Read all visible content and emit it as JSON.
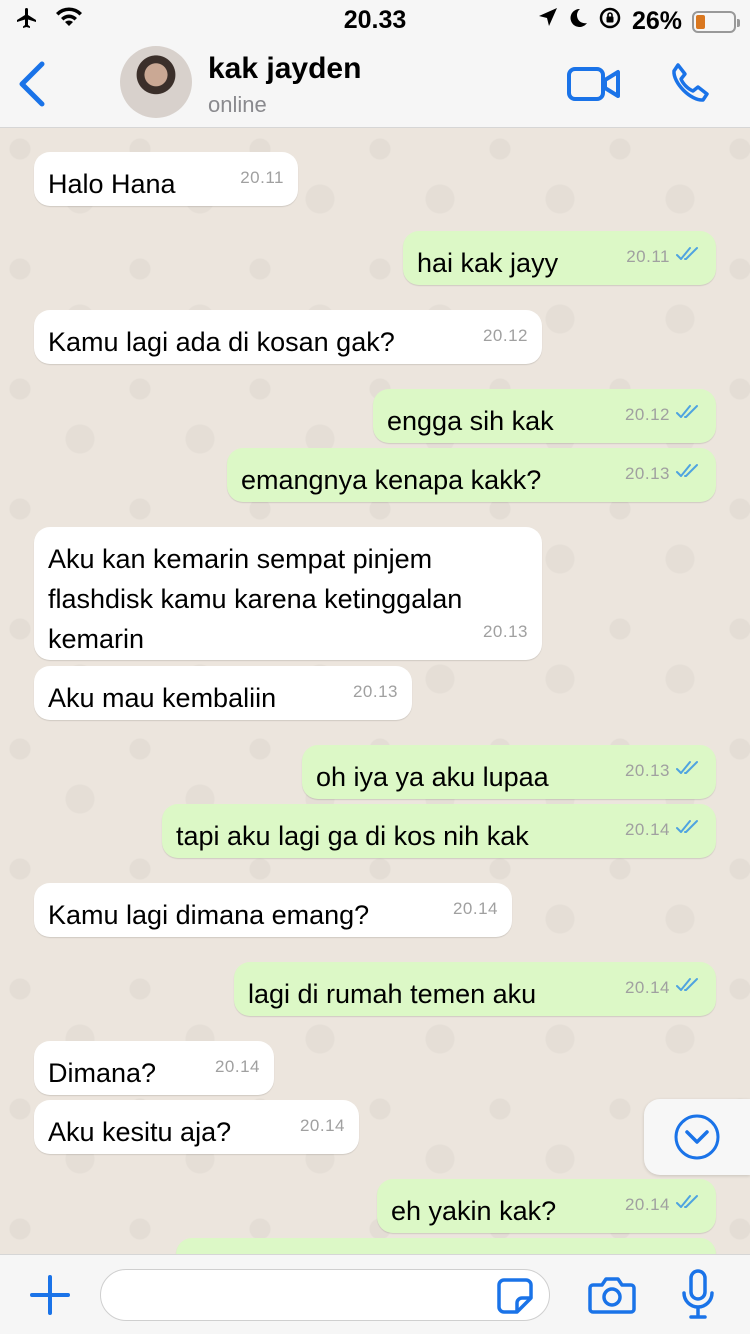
{
  "status_bar": {
    "time": "20.33",
    "battery_text": "26%",
    "battery_level": 0.26,
    "battery_color": "#d9771f"
  },
  "header": {
    "contact_name": "kak jayden",
    "contact_status": "online",
    "accent_color": "#1a73e8"
  },
  "messages": [
    {
      "dir": "in",
      "text": "Halo Hana",
      "time": "20.11"
    },
    {
      "dir": "out",
      "text": "hai kak jayy",
      "time": "20.11",
      "read": true
    },
    {
      "dir": "in",
      "text": "Kamu lagi ada di kosan gak?",
      "time": "20.12"
    },
    {
      "dir": "out",
      "text": "engga sih kak",
      "time": "20.12",
      "read": true
    },
    {
      "dir": "out",
      "text": "emangnya kenapa kakk?",
      "time": "20.13",
      "read": true
    },
    {
      "dir": "in",
      "text": "Aku kan kemarin sempat pinjem flashdisk kamu karena ketinggalan kemarin",
      "time": "20.13"
    },
    {
      "dir": "in",
      "text": "Aku mau kembaliin",
      "time": "20.13"
    },
    {
      "dir": "out",
      "text": "oh iya ya aku lupaa",
      "time": "20.13",
      "read": true
    },
    {
      "dir": "out",
      "text": "tapi aku lagi ga di kos nih kak",
      "time": "20.14",
      "read": true
    },
    {
      "dir": "in",
      "text": "Kamu lagi dimana emang?",
      "time": "20.14"
    },
    {
      "dir": "out",
      "text": "lagi di rumah temen aku",
      "time": "20.14",
      "read": true
    },
    {
      "dir": "in",
      "text": "Dimana?",
      "time": "20.14"
    },
    {
      "dir": "in",
      "text": "Aku kesitu aja?",
      "time": "20.14"
    },
    {
      "dir": "out",
      "text": "eh yakin kak?",
      "time": "20.14",
      "read": true
    }
  ],
  "input": {
    "placeholder": ""
  },
  "icons": {
    "airplane": "airplane-icon",
    "wifi": "wifi-icon",
    "location": "location-icon",
    "moon": "moon-icon",
    "lock": "rotation-lock-icon",
    "back": "chevron-left-icon",
    "video": "video-icon",
    "phone": "phone-icon",
    "scroll": "chevron-down-circle-icon",
    "plus": "plus-icon",
    "sticker": "sticker-icon",
    "camera": "camera-icon",
    "mic": "microphone-icon"
  }
}
